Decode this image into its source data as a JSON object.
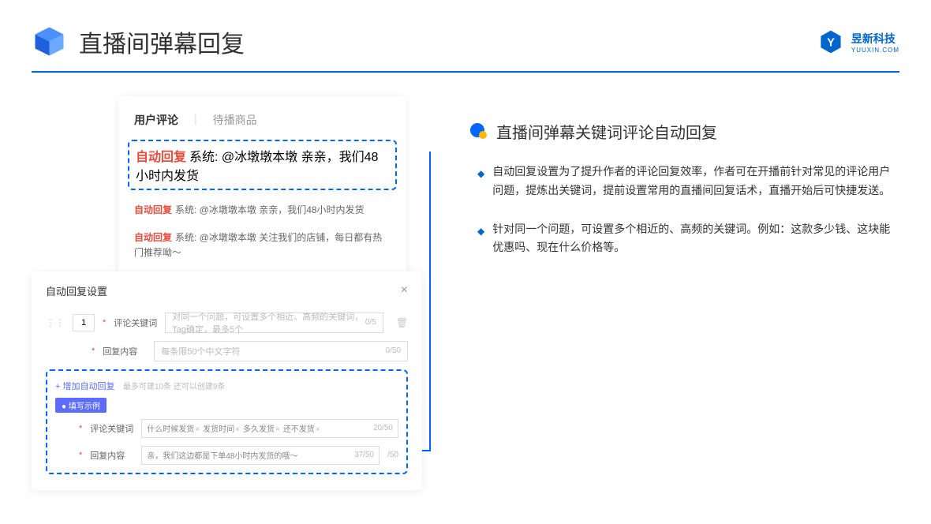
{
  "header": {
    "title": "直播间弹幕回复"
  },
  "brand": {
    "name_cn": "昱新科技",
    "name_en": "YUUXIN.COM"
  },
  "comments_panel": {
    "tabs": {
      "active": "用户评论",
      "inactive": "待播商品"
    },
    "badge": "自动回复",
    "rows": [
      "系统: @冰墩墩本墩 亲亲，我们48小时内发货",
      "系统: @冰墩墩本墩 亲亲，我们48小时内发货",
      "系统: @冰墩墩本墩 关注我们的店铺，每日都有热门推荐呦～"
    ]
  },
  "settings_panel": {
    "title": "自动回复设置",
    "index": "1",
    "keyword_label": "评论关键词",
    "keyword_placeholder": "对同一个问题，可设置多个相近、高频的关键词，Tag确定，最多5个",
    "keyword_count": "0/5",
    "reply_label": "回复内容",
    "reply_placeholder": "每条限50个中文字符",
    "reply_count": "0/50",
    "add_text": "+ 增加自动回复",
    "add_hint": "最多可建10条 还可以创建9条",
    "example_badge": "● 填写示例",
    "ex_keyword_label": "评论关键词",
    "ex_tags": [
      "什么时候发货",
      "发货时间",
      "多久发货",
      "还不发货"
    ],
    "ex_kw_count": "20/50",
    "ex_reply_label": "回复内容",
    "ex_reply_value": "亲，我们这边都是下单48小时内发货的哦～",
    "ex_reply_count": "37/50",
    "outer_count": "/50"
  },
  "section": {
    "title": "直播间弹幕关键词评论自动回复",
    "bullets": [
      "自动回复设置为了提升作者的评论回复效率，作者可在开播前针对常见的评论用户问题，提炼出关键词，提前设置常用的直播间回复话术，直播开始后可快捷发送。",
      "针对同一个问题，可设置多个相近的、高频的关键词。例如：这款多少钱、这块能优惠吗、现在什么价格等。"
    ]
  }
}
